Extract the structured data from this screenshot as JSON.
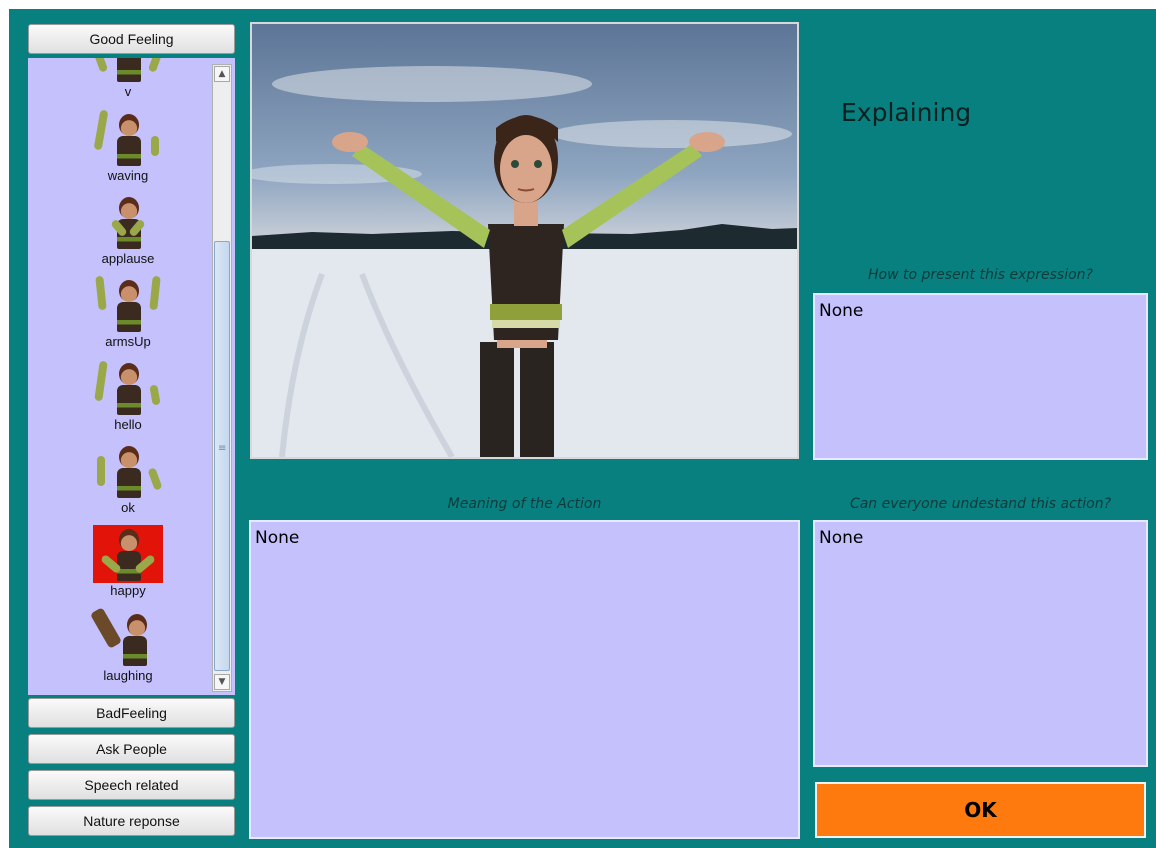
{
  "sidebar": {
    "categories_top": [
      {
        "label": "Good Feeling"
      }
    ],
    "items": [
      {
        "label": "v",
        "icon": "avatar-pose-v-icon"
      },
      {
        "label": "waving",
        "icon": "avatar-pose-waving-icon"
      },
      {
        "label": "applause",
        "icon": "avatar-pose-applause-icon"
      },
      {
        "label": "armsUp",
        "icon": "avatar-pose-armsup-icon"
      },
      {
        "label": "hello",
        "icon": "avatar-pose-hello-icon"
      },
      {
        "label": "ok",
        "icon": "avatar-pose-ok-icon"
      },
      {
        "label": "happy",
        "icon": "avatar-pose-happy-icon",
        "selected": true
      },
      {
        "label": "laughing",
        "icon": "avatar-pose-laughing-icon"
      }
    ],
    "categories_bottom": [
      {
        "label": "BadFeeling"
      },
      {
        "label": "Ask People"
      },
      {
        "label": "Speech related"
      },
      {
        "label": "Nature reponse"
      }
    ],
    "selected_color": "#e2140a"
  },
  "main": {
    "title": "Explaining",
    "present_label": "How to present this expression?",
    "present_value": "None",
    "meaning_label": "Meaning of the Action",
    "meaning_value": "None",
    "understand_label": "Can everyone undestand this action?",
    "understand_value": "None",
    "ok_label": "OK"
  },
  "colors": {
    "background": "#088080",
    "panel": "#c4c1fd",
    "ok_button": "#ff7a0e"
  }
}
